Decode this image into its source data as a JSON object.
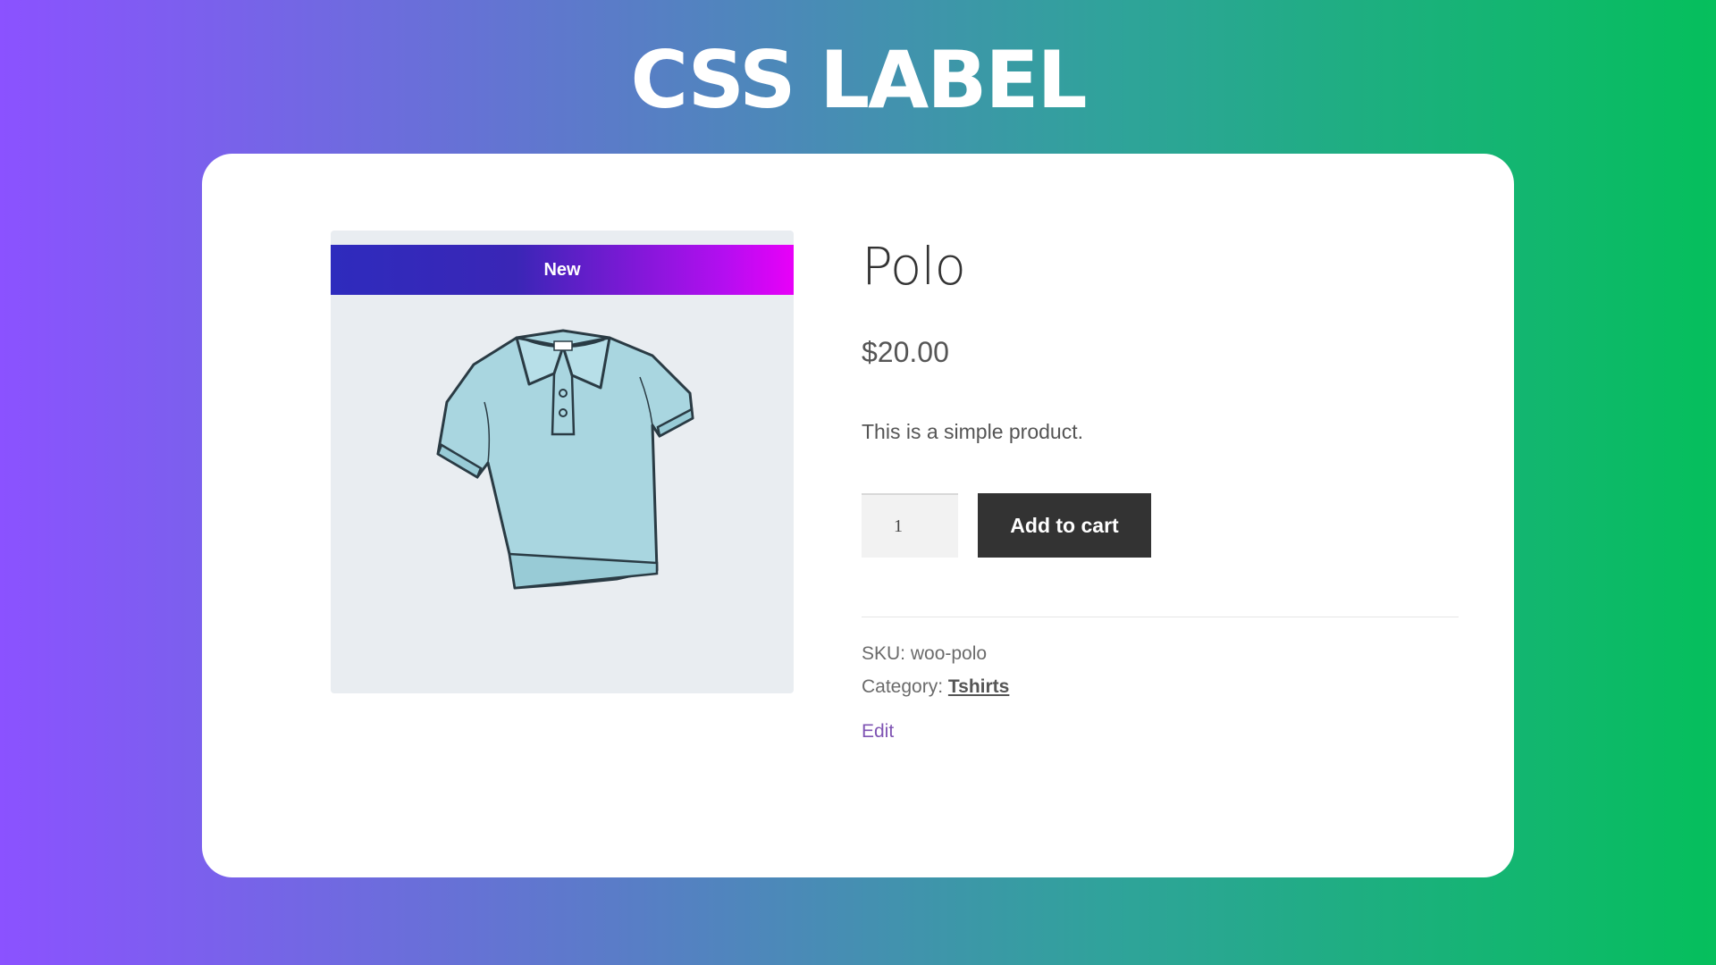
{
  "banner": {
    "title": "CSS LABEL"
  },
  "product": {
    "badge": "New",
    "title": "Polo",
    "price": "$20.00",
    "description": "This is a simple product.",
    "quantity": "1",
    "add_to_cart_label": "Add to cart",
    "sku_label": "SKU:",
    "sku_value": "woo-polo",
    "category_label": "Category:",
    "category_value": "Tshirts",
    "edit_label": "Edit",
    "image_icon": "polo-shirt-image"
  },
  "colors": {
    "badge_gradient_start": "#2e2bbd",
    "badge_gradient_end": "#e800f8",
    "button_bg": "#333333",
    "edit_link": "#7f54b3",
    "shirt_fill": "#a9d6e0"
  }
}
